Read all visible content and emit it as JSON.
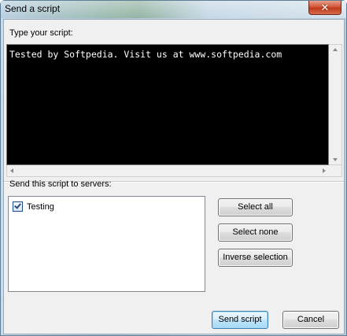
{
  "window": {
    "title": "Send a script",
    "close_glyph": "✕"
  },
  "script": {
    "label": "Type your script:",
    "content": "Tested by Softpedia. Visit us at www.softpedia.com"
  },
  "servers": {
    "label": "Send this script to servers:",
    "items": [
      {
        "label": "Testing",
        "checked": true
      }
    ]
  },
  "buttons": {
    "select_all": "Select all",
    "select_none": "Select none",
    "inverse_selection": "Inverse selection",
    "send_script": "Send script",
    "cancel": "Cancel"
  },
  "colors": {
    "script_background": "#000000",
    "script_text": "#ffffff",
    "close_button": "#c8432a",
    "default_button_border": "#3c7fb1"
  },
  "icons": {
    "close": "close-icon",
    "checkbox": "checkmark-icon"
  }
}
